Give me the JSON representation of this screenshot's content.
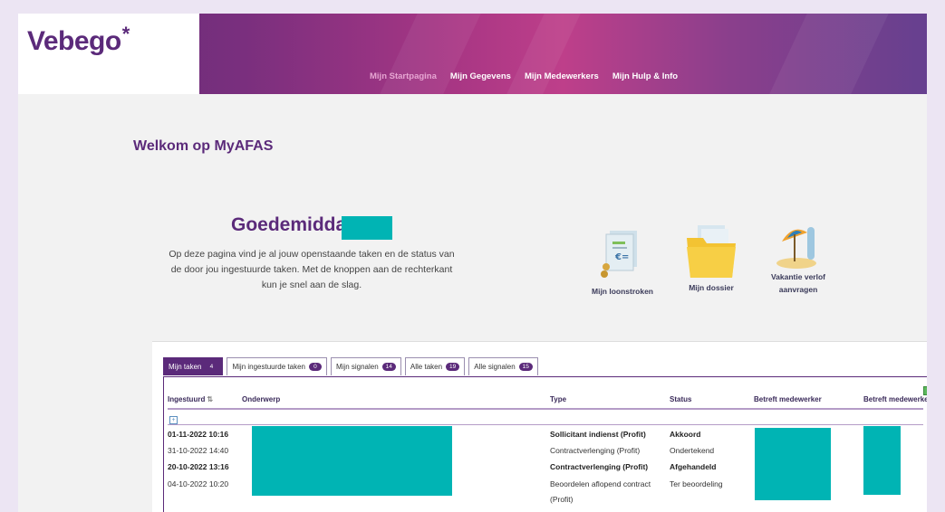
{
  "brand": {
    "logo_text": "Vebego",
    "logo_mark": "*",
    "color": "#5b2a7a",
    "accent": "#00b4b4"
  },
  "nav": {
    "items": [
      "Mijn Startpagina",
      "Mijn Gegevens",
      "Mijn Medewerkers",
      "Mijn Hulp & Info"
    ],
    "active": "Mijn Startpagina"
  },
  "page": {
    "welcome": "Welkom op MyAFAS",
    "greeting": "Goedemiddag",
    "intro": "Op deze pagina vind je al jouw openstaande taken en de status van de door jou ingestuurde taken. Met de knoppen aan de rechterkant kun je snel aan de slag."
  },
  "actions": [
    {
      "label": "Mijn loonstroken",
      "icon": "payslip-icon"
    },
    {
      "label": "Mijn dossier",
      "icon": "folder-icon"
    },
    {
      "label": "Vakantie verlof aanvragen",
      "icon": "beach-umbrella-icon"
    }
  ],
  "tabs": [
    {
      "label": "Mijn taken",
      "count": "4",
      "active": true
    },
    {
      "label": "Mijn ingestuurde taken",
      "count": "0"
    },
    {
      "label": "Mijn signalen",
      "count": "14"
    },
    {
      "label": "Alle taken",
      "count": "19"
    },
    {
      "label": "Alle signalen",
      "count": "15"
    }
  ],
  "table": {
    "columns": [
      "Ingestuurd",
      "Onderwerp",
      "Type",
      "Status",
      "Betreft medewerker",
      "Betreft medewerke"
    ],
    "rows": [
      {
        "ingestuurd": "01-11-2022 10:16",
        "type": "Sollicitant indienst (Profit)",
        "status": "Akkoord",
        "bold": true
      },
      {
        "ingestuurd": "31-10-2022 14:40",
        "type": "Contractverlenging (Profit)",
        "status": "Ondertekend",
        "bold": false
      },
      {
        "ingestuurd": "20-10-2022 13:16",
        "type": "Contractverlenging (Profit)",
        "status": "Afgehandeld",
        "bold": true
      },
      {
        "ingestuurd": "04-10-2022 10:20",
        "type": "Beoordelen aflopend contract",
        "type_cont": "(Profit)",
        "status": "Ter beoordeling",
        "bold": false
      }
    ]
  }
}
